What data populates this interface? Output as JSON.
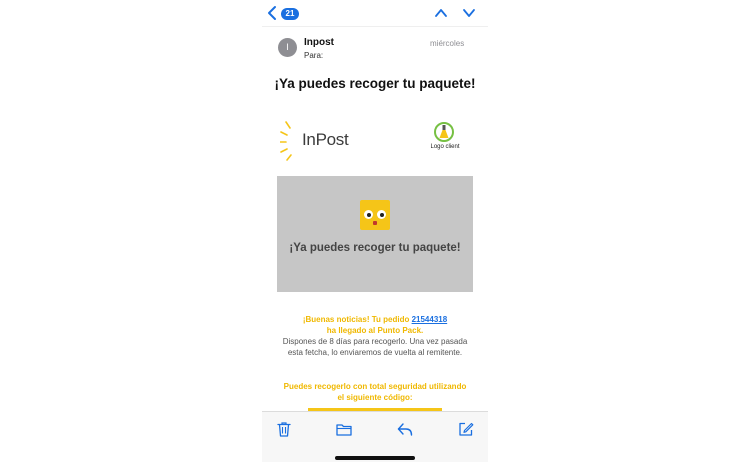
{
  "nav": {
    "unread_count": "21"
  },
  "sender": {
    "avatar_initial": "I",
    "name": "Inpost",
    "to_label": "Para:",
    "date": "miércoles"
  },
  "subject": "¡Ya puedes recoger tu paquete!",
  "logos": {
    "inpost_text": "InPost",
    "client_text": "Logo client"
  },
  "banner": {
    "title": "¡Ya puedes recoger tu paquete!"
  },
  "message": {
    "good_news": "¡Buenas noticias! Tu pedido",
    "order_number": "21544318",
    "arrived": "ha llegado al Punto Pack.",
    "pickup_info": "Dispones de 8 días para recogerlo. Una vez pasada esta fetcha, lo enviaremos de vuelta al remitente.",
    "security": "Puedes recogerlo con total seguridad utilizando el siguiente código:"
  },
  "colors": {
    "accent_blue": "#1a6fe0",
    "inpost_yellow": "#f5c518",
    "banner_gray": "#c6c6c6"
  },
  "icons": {
    "toolbar": [
      "trash-icon",
      "folder-icon",
      "reply-icon",
      "compose-icon"
    ]
  }
}
